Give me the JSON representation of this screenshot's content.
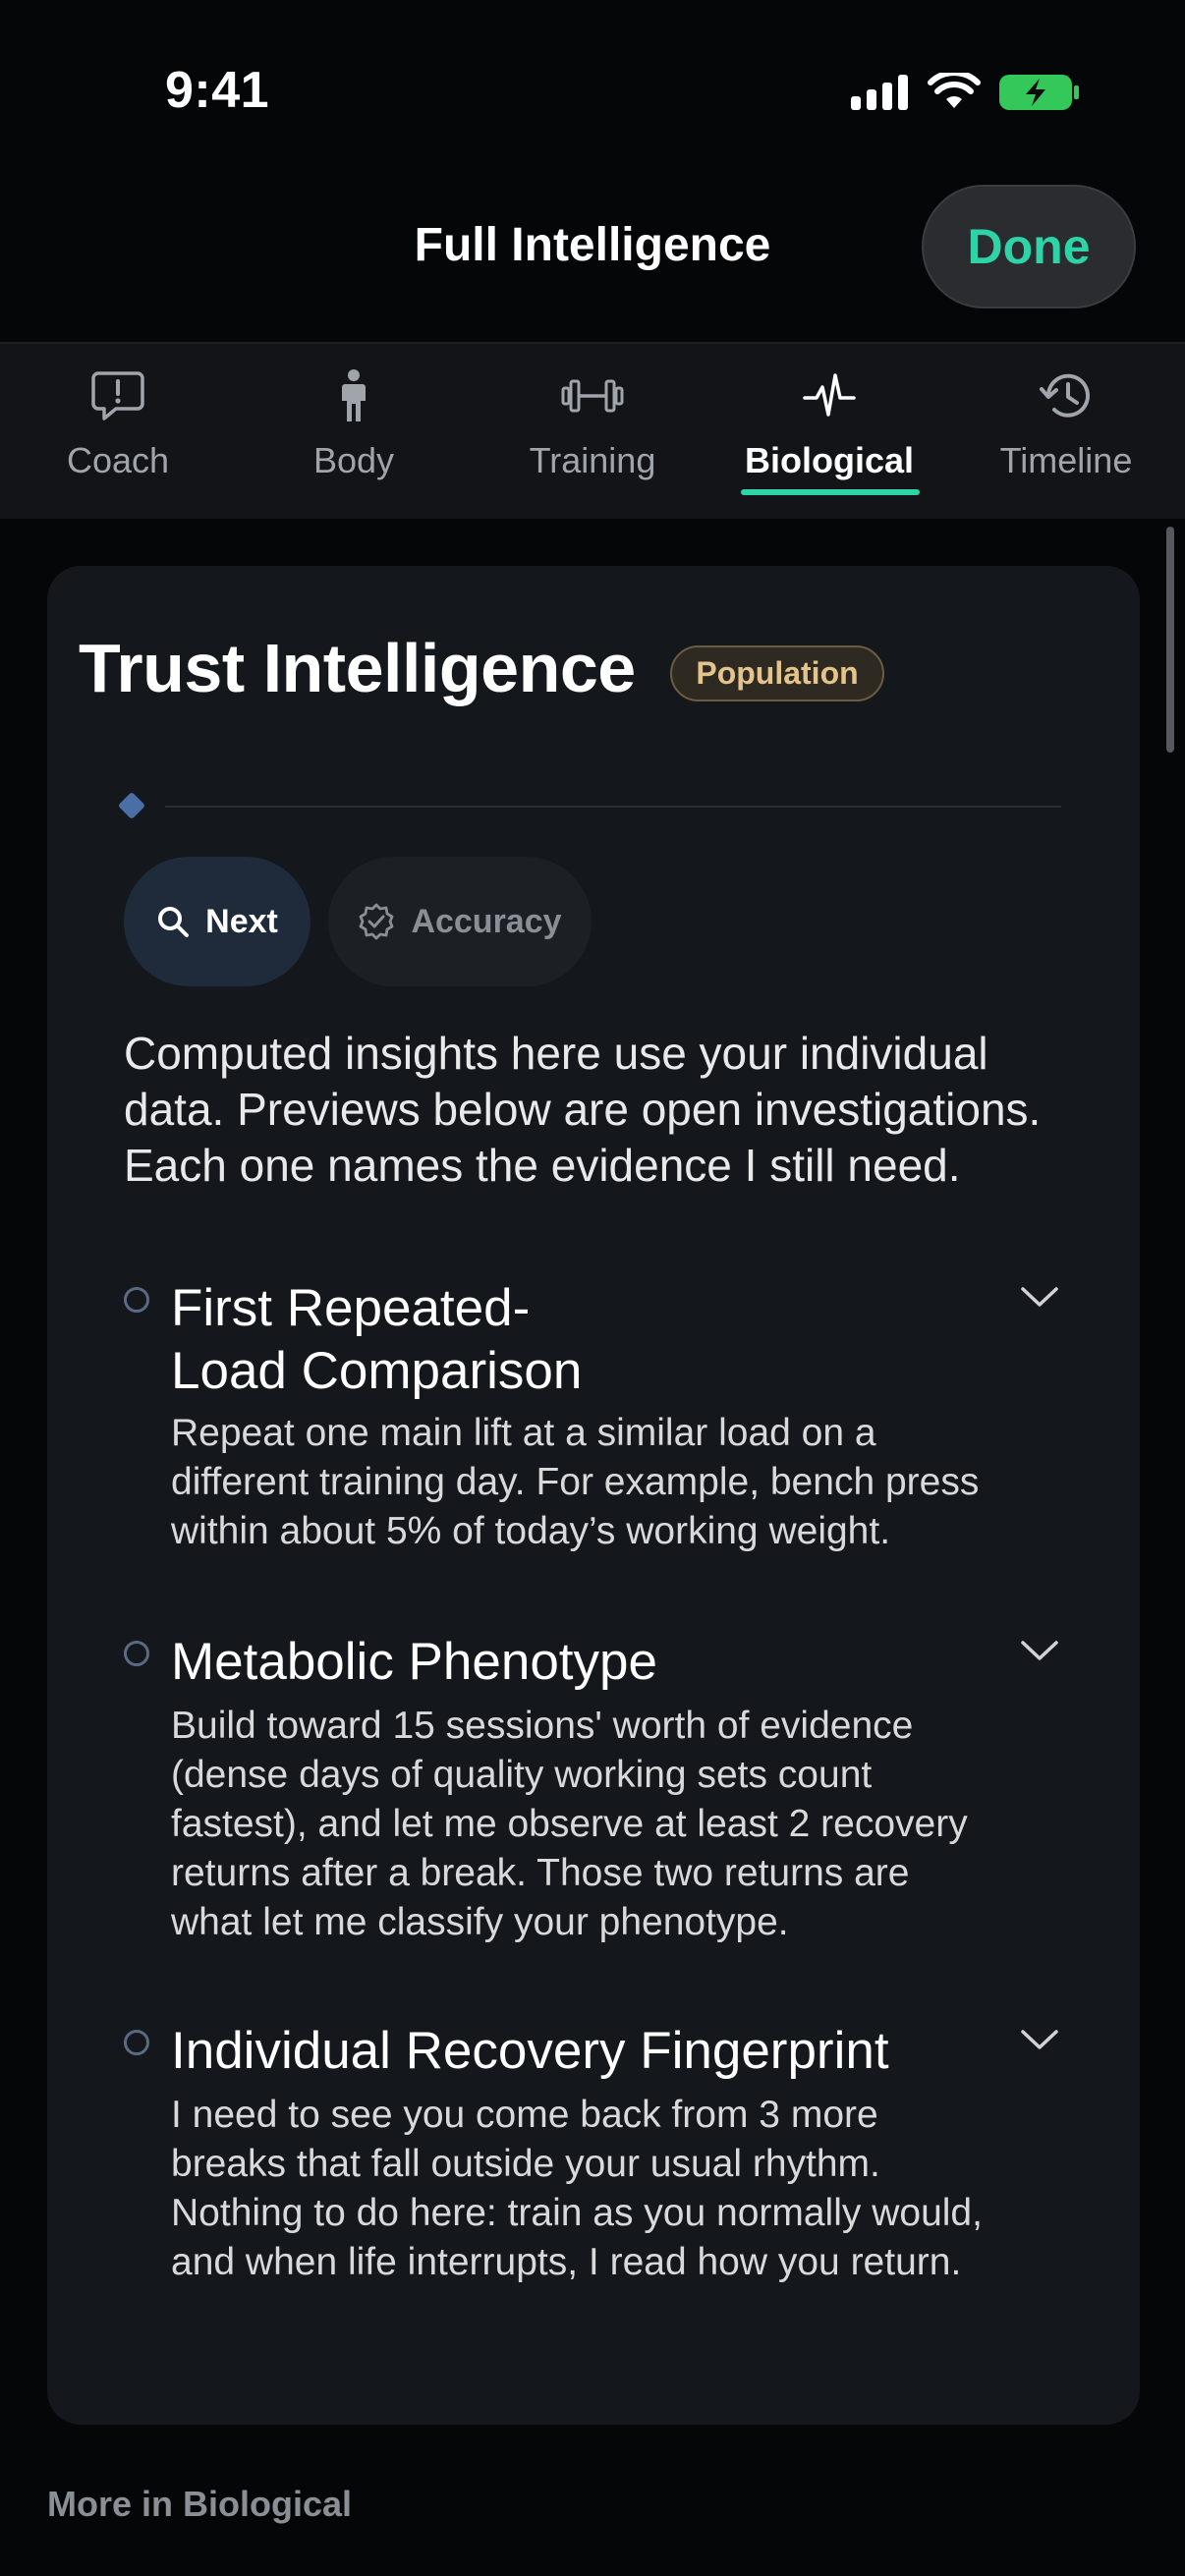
{
  "status_bar": {
    "time": "9:41"
  },
  "header": {
    "title": "Full Intelligence",
    "done_label": "Done"
  },
  "tabs": [
    {
      "label": "Coach",
      "icon": "chat-alert-icon"
    },
    {
      "label": "Body",
      "icon": "person-icon"
    },
    {
      "label": "Training",
      "icon": "dumbbell-icon"
    },
    {
      "label": "Biological",
      "icon": "pulse-icon",
      "active": true
    },
    {
      "label": "Timeline",
      "icon": "history-icon"
    }
  ],
  "card": {
    "title": "Trust Intelligence",
    "badge": "Population",
    "chips": {
      "next": "Next",
      "accuracy": "Accuracy"
    },
    "intro": "Computed insights here use your individual data. Previews below are open investigations. Each one names the evidence I still need.",
    "items": [
      {
        "title": "First Repeated-\nLoad Comparison",
        "description": "Repeat one main lift at a similar load on a different training day. For example, bench press within about 5% of today’s working weight."
      },
      {
        "title": "Metabolic Phenotype",
        "description": "Build toward 15 sessions' worth of evidence (dense days of quality working sets count fastest), and let me observe at least 2 recovery returns after a break. Those two returns are what let me classify your phenotype."
      },
      {
        "title": "Individual Recovery Fingerprint",
        "description": "I need to see you come back from 3 more breaks that fall outside your usual rhythm. Nothing to do here: train as you normally would, and when life interrupts, I read how you return."
      }
    ]
  },
  "footer": {
    "more_label": "More in Biological"
  },
  "colors": {
    "accent": "#2ed3a8",
    "badge_text": "#e3c48c",
    "card_bg": "#14171b"
  }
}
